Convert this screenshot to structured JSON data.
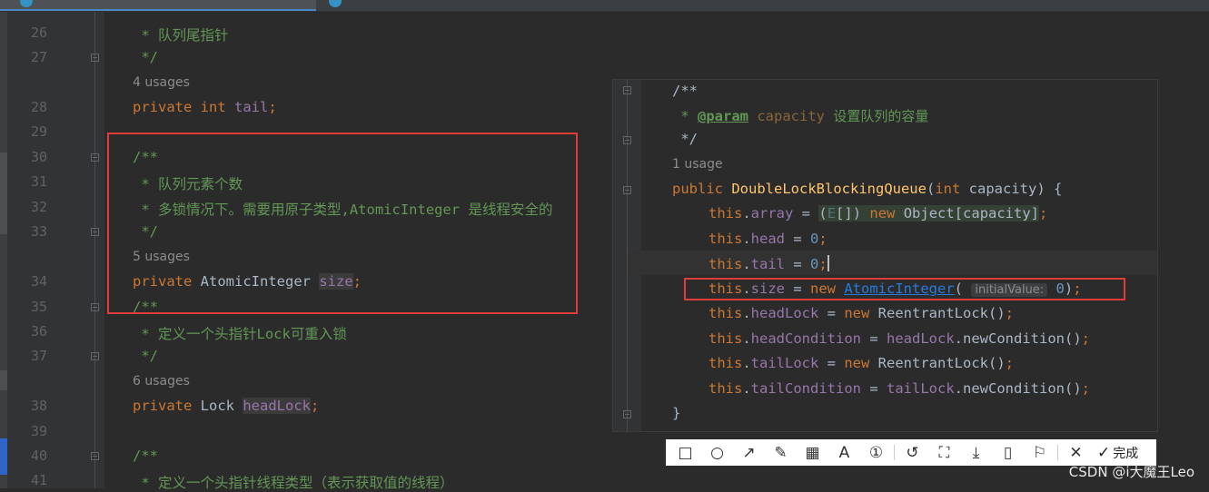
{
  "left_code": [
    {
      "ln": "26",
      "text": " * 队列尾指针"
    },
    {
      "ln": "27",
      "text": " */"
    },
    {
      "usages": "4 usages"
    },
    {
      "ln": "28",
      "kw": "private",
      "type": "int",
      "name": "tail",
      "semi": ";"
    },
    {
      "ln": "29"
    },
    {
      "ln": "30",
      "text": "/**"
    },
    {
      "ln": "31",
      "text": " * 队列元素个数"
    },
    {
      "ln": "32",
      "text": " * 多锁情况下。需要用原子类型,AtomicInteger 是线程安全的"
    },
    {
      "ln": "33",
      "text": " */"
    },
    {
      "usages": "5 usages"
    },
    {
      "ln": "34",
      "kw": "private",
      "type": "AtomicInteger",
      "name": "size",
      "semi": ";"
    },
    {
      "ln": "35",
      "text": "/**"
    },
    {
      "ln": "36",
      "text": " * 定义一个头指针Lock可重入锁"
    },
    {
      "ln": "37",
      "text": " */"
    },
    {
      "usages": "6 usages"
    },
    {
      "ln": "38",
      "kw": "private",
      "type": "Lock",
      "name": "headLock",
      "semi": ";"
    },
    {
      "ln": "39"
    },
    {
      "ln": "40",
      "text": "/**"
    },
    {
      "ln": "41",
      "text": " * 定义一个头指针线程类型（表示获取值的线程）"
    }
  ],
  "popup": {
    "doc_open": "/**",
    "doc_star": " * ",
    "param_tag": "@param",
    "param_name": "capacity",
    "param_desc": "设置队列的容量",
    "doc_close": " */",
    "usages": "1 usage",
    "kw_public": "public",
    "ctor_name": "DoubleLockBlockingQueue",
    "paren_open": "(",
    "kw_int": "int",
    "arg_name": " capacity) {",
    "this": "this",
    "dot": ".",
    "f_array": "array",
    "f_head": "head",
    "f_tail": "tail",
    "f_size": "size",
    "f_headLock": "headLock",
    "f_headCondition": "headCondition",
    "f_tailLock": "tailLock",
    "f_tailCondition": "tailCondition",
    "assign": " = ",
    "semi": ";",
    "kw_new": "new",
    "cast_open": "(",
    "generic": "E",
    "cast_close": "[]) ",
    "object_expr": "Object[capacity]",
    "zero": "0",
    "atomic_cls": "AtomicInteger",
    "hint_label": "initialValue:",
    "close_paren": ")",
    "reentrant": "ReentrantLock",
    "call_parens": "()",
    "new_condition": "newCondition",
    "closing_brace": "}"
  },
  "toolbar": {
    "items": [
      "□",
      "○",
      "↗",
      "✎",
      "▦",
      "A",
      "①",
      "↺",
      "⛶",
      "⤓",
      "▯",
      "⚐",
      "✕"
    ],
    "icon_names": [
      "rectangle-icon",
      "ellipse-icon",
      "arrow-icon",
      "pen-icon",
      "mosaic-icon",
      "text-icon",
      "number-icon",
      "undo-icon",
      "screenshot-icon",
      "download-icon",
      "pin-icon",
      "bookmark-icon",
      "close-icon"
    ],
    "done_check": "✓",
    "done_label": "完成"
  },
  "watermark": "CSDN @i大魔王Leo",
  "colors": {
    "background": "#2b2b2b",
    "keyword": "#cc7832",
    "field": "#9876aa",
    "comment": "#629755",
    "annotation_box": "#e03c3c"
  }
}
